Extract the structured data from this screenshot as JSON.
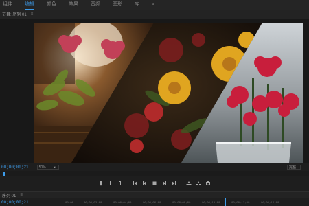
{
  "workspace": {
    "tabs": [
      {
        "label": "组件",
        "active": false
      },
      {
        "label": "编辑",
        "active": true
      },
      {
        "label": "颜色",
        "active": false
      },
      {
        "label": "效果",
        "active": false
      },
      {
        "label": "音频",
        "active": false
      },
      {
        "label": "图形",
        "active": false
      },
      {
        "label": "库",
        "active": false
      }
    ],
    "more_icon": "double-chevron-right-icon"
  },
  "program_monitor": {
    "title": "节目: 序列 01",
    "menu_icon": "hamburger-menu-icon",
    "timecode": "00;00;00;21",
    "zoom": "50%",
    "quality": "完整"
  },
  "transport_icons": [
    "add-marker-icon",
    "mark-in-icon",
    "mark-out-icon",
    "go-to-in-icon",
    "step-back-icon",
    "stop-icon",
    "step-forward-icon",
    "go-to-out-icon",
    "lift-icon",
    "extract-icon",
    "export-frame-icon"
  ],
  "timeline": {
    "title": "序列 01",
    "menu_icon": "hamburger-menu-icon",
    "timecode": "00;00;00;21",
    "ticks": [
      "00;00",
      "00;00;02;00",
      "00;00;04;00",
      "00;00;06;00",
      "00;00;08;00",
      "00;00;10;00",
      "00;00;12;00",
      "00;00;14;00"
    ]
  },
  "colors": {
    "accent": "#3d9be9",
    "background": "#1e1e1e"
  }
}
